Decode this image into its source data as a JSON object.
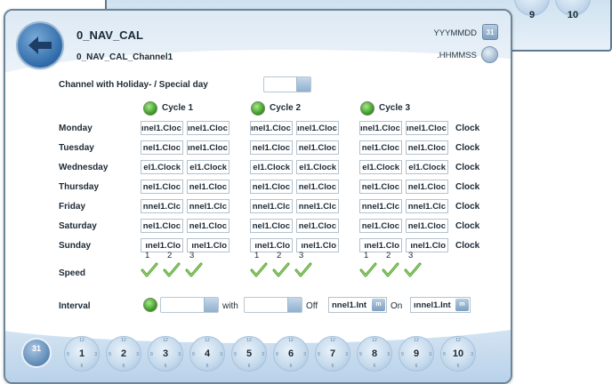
{
  "header": {
    "title": "0_NAV_CAL",
    "subtitle": "0_NAV_CAL_Channel1",
    "date_format": "YYYMMDD",
    "time_format": ".HHMMSS",
    "cal_icon_text": "31"
  },
  "holiday": {
    "label": "Channel with Holiday- / Special day",
    "value": ""
  },
  "cycles": [
    "Cycle 1",
    "Cycle 2",
    "Cycle 3"
  ],
  "trailing_label": "Clock",
  "days": [
    {
      "name": "Monday",
      "cells": [
        "ınel1.Cloc",
        "ınel1.Cloc",
        "ınel1.Cloc",
        "ınel1.Cloc",
        "ınel1.Cloc",
        "ınel1.Cloc"
      ]
    },
    {
      "name": "Tuesday",
      "cells": [
        "nel1.Cloc",
        "ınel1.Cloc",
        "nel1.Cloc",
        "nel1.Cloc",
        "nel1.Cloc",
        "nel1.Cloc"
      ]
    },
    {
      "name": "Wednesday",
      "cells": [
        "el1.Clock",
        "el1.Clock",
        "el1.Clock",
        "el1.Clock",
        "el1.Clock",
        "el1.Clock"
      ]
    },
    {
      "name": "Thursday",
      "cells": [
        "nel1.Cloc",
        "nel1.Cloc",
        "nel1.Cloc",
        "nel1.Cloc",
        "nel1.Cloc",
        "nel1.Cloc"
      ]
    },
    {
      "name": "Friday",
      "cells": [
        "nnel1.Clc",
        "nnel1.Clc",
        "nnel1.Clc",
        "nnel1.Clc",
        "nnel1.Clc",
        "nnel1.Clc"
      ]
    },
    {
      "name": "Saturday",
      "cells": [
        "nel1.Cloc",
        "nel1.Cloc",
        "nel1.Cloc",
        "nel1.Cloc",
        "nel1.Cloc",
        "nel1.Cloc"
      ]
    },
    {
      "name": "Sunday",
      "cells": [
        "ınel1.Clo",
        "ınel1.Clo",
        "ınel1.Clo",
        "ınel1.Clo",
        "ınel1.Clo",
        "ınel1.Clo"
      ]
    }
  ],
  "speed": {
    "label": "Speed",
    "numbers": [
      "1",
      "2",
      "3"
    ]
  },
  "interval": {
    "label": "Interval",
    "with_label": "with",
    "off_label": "Off",
    "on_label": "On",
    "off_value": "nnel1.Int",
    "on_value": "ınnel1.Int",
    "unit": "m"
  },
  "footer": {
    "calendar_text": "31",
    "clock_top": "12",
    "clock_bottom": "6",
    "clock_left": "9",
    "clock_right": "3",
    "clocks": [
      "1",
      "2",
      "3",
      "4",
      "5",
      "6",
      "7",
      "8",
      "9",
      "10"
    ]
  },
  "background_window": {
    "clocks": [
      "9",
      "10"
    ]
  },
  "colors": {
    "panel_border": "#6b8599",
    "header_bg": "#dde9f4",
    "led_green": "#3b9a25",
    "accent_blue": "#2f6aa8"
  }
}
